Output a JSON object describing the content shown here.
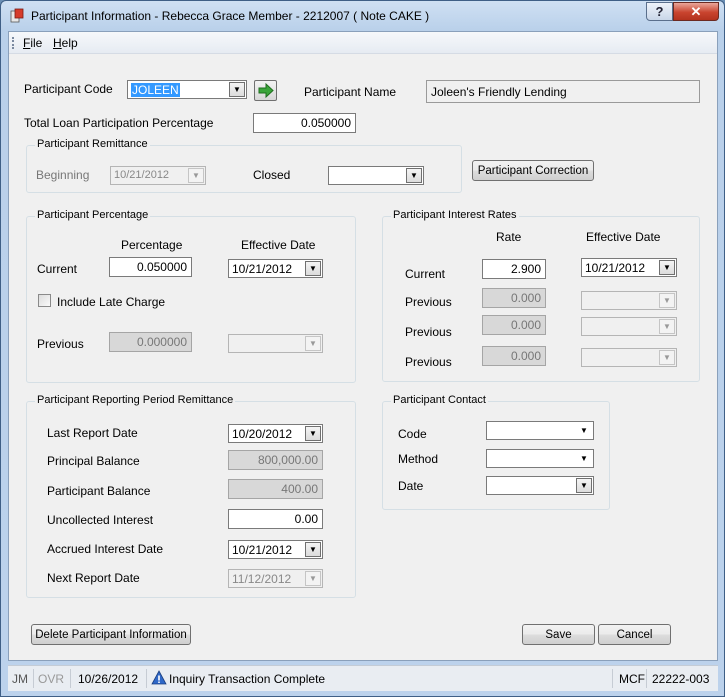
{
  "window": {
    "title": "Participant Information - Rebecca Grace Member - 2212007 ( Note   CAKE )",
    "help_button": "?",
    "close_button": "✕"
  },
  "menu": {
    "file": "File",
    "help": "Help"
  },
  "participant": {
    "code_label": "Participant Code",
    "code_value": "JOLEEN",
    "name_label": "Participant Name",
    "name_value": "Joleen's Friendly Lending",
    "total_pct_label": "Total Loan Participation Percentage",
    "total_pct_value": "0.050000"
  },
  "remittance": {
    "title": "Participant Remittance",
    "beginning_label": "Beginning",
    "beginning_value": "10/21/2012",
    "closed_label": "Closed",
    "closed_value": "",
    "correction_button": "Participant Correction"
  },
  "percentage": {
    "title": "Participant Percentage",
    "col_pct": "Percentage",
    "col_date": "Effective Date",
    "current_label": "Current",
    "current_pct": "0.050000",
    "current_date": "10/21/2012",
    "late_charge_label": "Include Late Charge",
    "late_charge_checked": false,
    "previous_label": "Previous",
    "previous_pct": "0.000000",
    "previous_date": ""
  },
  "interest": {
    "title": "Participant Interest Rates",
    "col_rate": "Rate",
    "col_date": "Effective Date",
    "rows": [
      {
        "label": "Current",
        "rate": "2.900",
        "date": "10/21/2012"
      },
      {
        "label": "Previous",
        "rate": "0.000",
        "date": ""
      },
      {
        "label": "Previous",
        "rate": "0.000",
        "date": ""
      },
      {
        "label": "Previous",
        "rate": "0.000",
        "date": ""
      }
    ]
  },
  "reporting": {
    "title": "Participant Reporting Period Remittance",
    "last_report_label": "Last Report Date",
    "last_report_value": "10/20/2012",
    "principal_label": "Principal Balance",
    "principal_value": "800,000.00",
    "participant_bal_label": "Participant Balance",
    "participant_bal_value": "400.00",
    "uncollected_label": "Uncollected Interest",
    "uncollected_value": "0.00",
    "accrued_label": "Accrued Interest Date",
    "accrued_value": "10/21/2012",
    "next_report_label": "Next Report Date",
    "next_report_value": "11/12/2012"
  },
  "contact": {
    "title": "Participant Contact",
    "code_label": "Code",
    "code_value": "",
    "method_label": "Method",
    "method_value": "",
    "date_label": "Date",
    "date_value": ""
  },
  "buttons": {
    "delete": "Delete Participant Information",
    "save": "Save",
    "cancel": "Cancel"
  },
  "status": {
    "user": "JM",
    "ovr": "OVR",
    "date": "10/26/2012",
    "message": "Inquiry Transaction Complete",
    "system": "MCF",
    "version": "22222-003"
  },
  "colors": {
    "selection": "#3399ff",
    "close_button": "#c9442f",
    "go_arrow": "#3aa53a"
  }
}
